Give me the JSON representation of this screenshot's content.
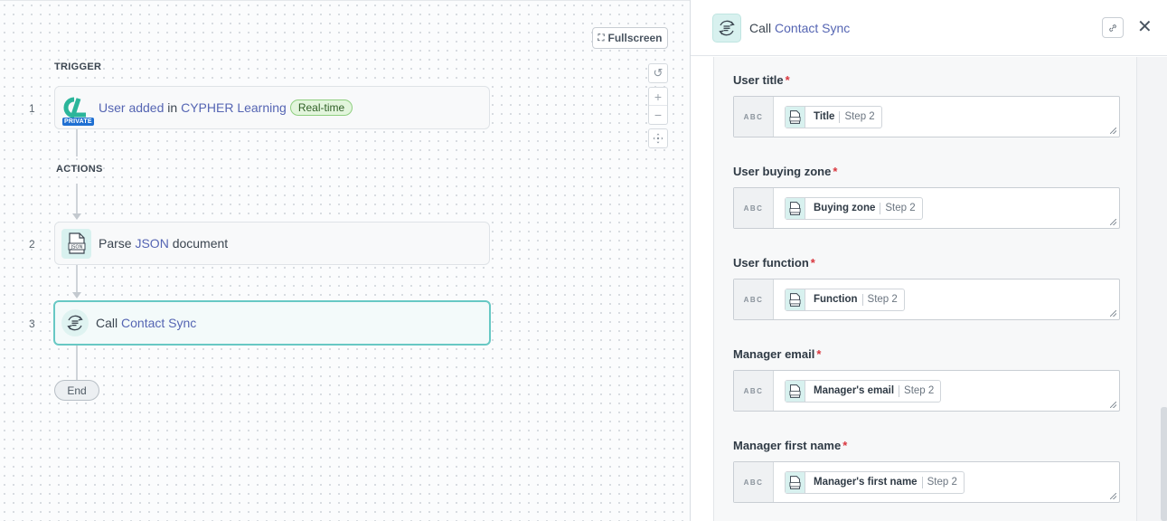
{
  "canvas": {
    "fullscreen_label": "Fullscreen",
    "trigger_label": "TRIGGER",
    "actions_label": "ACTIONS",
    "end_label": "End",
    "steps": [
      {
        "num": "1",
        "pre": "User added",
        "mid": " in ",
        "link": "CYPHER Learning",
        "badge": "Real-time",
        "private": "PRIVATE"
      },
      {
        "num": "2",
        "pre": "Parse ",
        "link": "JSON",
        "post": " document",
        "icon_text": "JSON"
      },
      {
        "num": "3",
        "pre": "Call ",
        "link": "Contact Sync"
      }
    ]
  },
  "panel": {
    "title_prefix": "Call ",
    "title_link": "Contact Sync",
    "type_tag": "ABC",
    "step_ref": "Step 2",
    "fields": [
      {
        "label": "User title",
        "pill": "Title"
      },
      {
        "label": "User buying zone",
        "pill": "Buying zone"
      },
      {
        "label": "User function",
        "pill": "Function"
      },
      {
        "label": "Manager email",
        "pill": "Manager's email"
      },
      {
        "label": "Manager first name",
        "pill": "Manager's first name"
      }
    ]
  },
  "colors": {
    "accent": "#67c8c4",
    "link": "#5565b3",
    "required": "#d9363e",
    "badge_bg": "#e2f5dc"
  }
}
